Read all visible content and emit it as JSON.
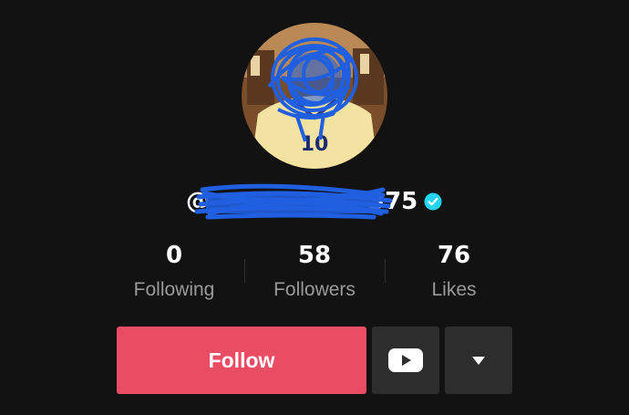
{
  "profile": {
    "handle_prefix": "@",
    "handle_visible_suffix": "375",
    "verified": true,
    "jersey_number": "10"
  },
  "stats": [
    {
      "value": "0",
      "label": "Following"
    },
    {
      "value": "58",
      "label": "Followers"
    },
    {
      "value": "76",
      "label": "Likes"
    }
  ],
  "actions": {
    "follow_label": "Follow",
    "youtube_icon": "youtube-icon",
    "more_icon": "dropdown-arrow-icon"
  },
  "colors": {
    "background": "#121212",
    "follow_button": "#ea4c63",
    "icon_button": "#2d2d2d",
    "verified_badge": "#20d5ec",
    "redaction_scribble": "#1f5fe0"
  }
}
